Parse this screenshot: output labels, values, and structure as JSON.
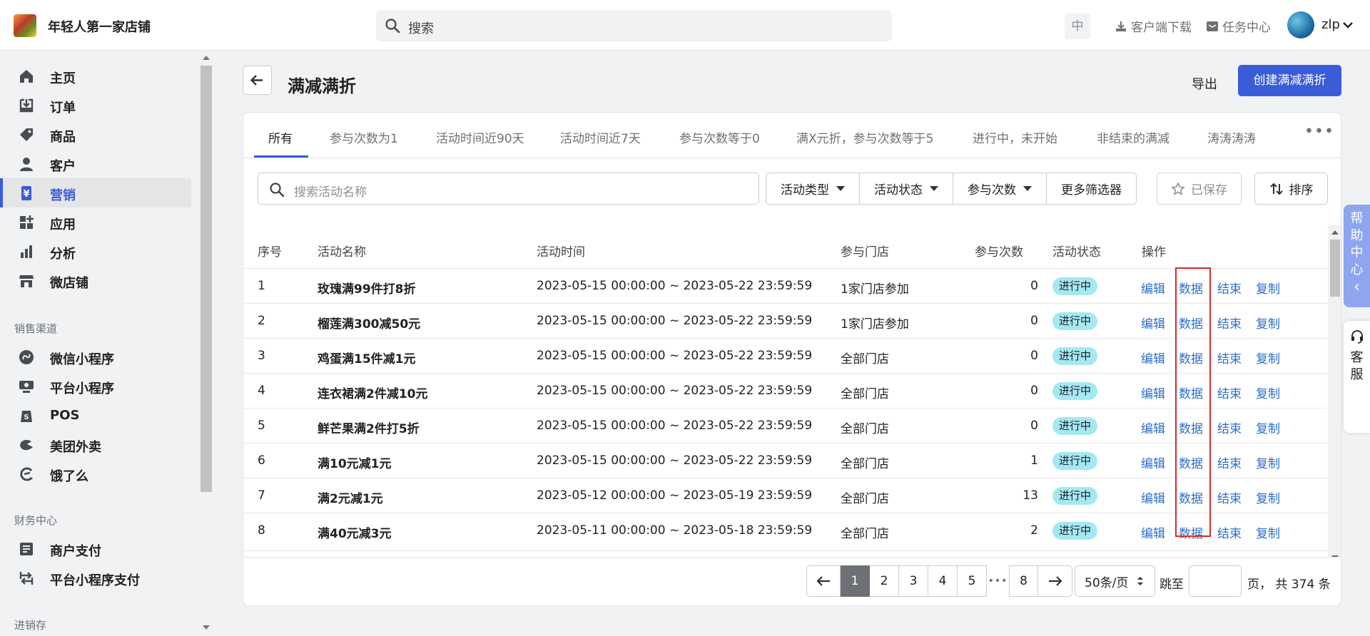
{
  "store": {
    "name": "年轻人第一家店铺"
  },
  "topbar": {
    "search_placeholder": "搜索",
    "lang": "中",
    "download": "客户端下载",
    "tasks": "任务中心",
    "username": "zlp"
  },
  "sidebar": {
    "main_items": [
      {
        "label": "主页",
        "icon": "home-icon"
      },
      {
        "label": "订单",
        "icon": "orders-icon"
      },
      {
        "label": "商品",
        "icon": "tag-icon"
      },
      {
        "label": "客户",
        "icon": "person-icon"
      },
      {
        "label": "营销",
        "icon": "marketing-icon",
        "active": true
      },
      {
        "label": "应用",
        "icon": "apps-icon"
      },
      {
        "label": "分析",
        "icon": "bar-chart-icon"
      },
      {
        "label": "微店铺",
        "icon": "store-icon"
      }
    ],
    "sales_channels_label": "销售渠道",
    "sales_channels": [
      {
        "label": "微信小程序",
        "icon": "wechat-miniprogram-icon"
      },
      {
        "label": "平台小程序",
        "icon": "platform-miniprogram-icon"
      },
      {
        "label": "POS",
        "icon": "pos-icon"
      },
      {
        "label": "美团外卖",
        "icon": "meituan-icon"
      },
      {
        "label": "饿了么",
        "icon": "eleme-icon"
      }
    ],
    "finance_label": "财务中心",
    "finance_items": [
      {
        "label": "商户支付",
        "icon": "document-icon"
      },
      {
        "label": "平台小程序支付",
        "icon": "transfer-icon"
      }
    ],
    "inventory_label": "进销存"
  },
  "page": {
    "title": "满减满折",
    "export_label": "导出",
    "create_label": "创建满减满折"
  },
  "tabs": [
    {
      "label": "所有",
      "active": true
    },
    {
      "label": "参与次数为1"
    },
    {
      "label": "活动时间近90天"
    },
    {
      "label": "活动时间近7天"
    },
    {
      "label": "参与次数等于0"
    },
    {
      "label": "满X元折，参与次数等于5"
    },
    {
      "label": "进行中，未开始"
    },
    {
      "label": "非结束的满减"
    },
    {
      "label": "涛涛涛涛"
    }
  ],
  "tabs_more": "•••",
  "filters": {
    "search_placeholder": "搜索活动名称",
    "activity_type": "活动类型",
    "activity_status": "活动状态",
    "participation": "参与次数",
    "more_filters": "更多筛选器",
    "saved": "已保存",
    "sort": "排序"
  },
  "table": {
    "headers": {
      "index": "序号",
      "name": "活动名称",
      "time": "活动时间",
      "stores": "参与门店",
      "count": "参与次数",
      "status": "活动状态",
      "actions": "操作"
    },
    "actions": {
      "edit": "编辑",
      "data": "数据",
      "end": "结束",
      "copy": "复制"
    },
    "rows": [
      {
        "index": "1",
        "name": "玫瑰满99件打8折",
        "time": "2023-05-15 00:00:00 ~ 2023-05-22 23:59:59",
        "stores": "1家门店参加",
        "count": "0",
        "status": "进行中"
      },
      {
        "index": "2",
        "name": "榴莲满300减50元",
        "time": "2023-05-15 00:00:00 ~ 2023-05-22 23:59:59",
        "stores": "1家门店参加",
        "count": "0",
        "status": "进行中"
      },
      {
        "index": "3",
        "name": "鸡蛋满15件减1元",
        "time": "2023-05-15 00:00:00 ~ 2023-05-22 23:59:59",
        "stores": "全部门店",
        "count": "0",
        "status": "进行中"
      },
      {
        "index": "4",
        "name": "连衣裙满2件减10元",
        "time": "2023-05-15 00:00:00 ~ 2023-05-22 23:59:59",
        "stores": "全部门店",
        "count": "0",
        "status": "进行中"
      },
      {
        "index": "5",
        "name": "鲜芒果满2件打5折",
        "time": "2023-05-15 00:00:00 ~ 2023-05-22 23:59:59",
        "stores": "全部门店",
        "count": "0",
        "status": "进行中"
      },
      {
        "index": "6",
        "name": "满10元减1元",
        "time": "2023-05-15 00:00:00 ~ 2023-05-22 23:59:59",
        "stores": "全部门店",
        "count": "1",
        "status": "进行中"
      },
      {
        "index": "7",
        "name": "满2元减1元",
        "time": "2023-05-12 00:00:00 ~ 2023-05-19 23:59:59",
        "stores": "全部门店",
        "count": "13",
        "status": "进行中"
      },
      {
        "index": "8",
        "name": "满40元减3元",
        "time": "2023-05-11 00:00:00 ~ 2023-05-18 23:59:59",
        "stores": "全部门店",
        "count": "2",
        "status": "进行中"
      }
    ]
  },
  "pagination": {
    "pages": [
      "1",
      "2",
      "3",
      "4",
      "5"
    ],
    "dots": "•••",
    "last_page": "8",
    "current": "1",
    "per_page": "50条/页",
    "jump_label": "跳至",
    "total": "页， 共 374 条"
  },
  "help": {
    "chars": [
      "帮",
      "助",
      "中",
      "心"
    ],
    "arrow": "‹"
  },
  "service": {
    "chars": [
      "客",
      "服"
    ]
  },
  "colors": {
    "accent": "#3b5cd9",
    "link": "#2c6ecb",
    "status_badge": "#a4e8f2",
    "highlight_box": "#d92b2b"
  }
}
